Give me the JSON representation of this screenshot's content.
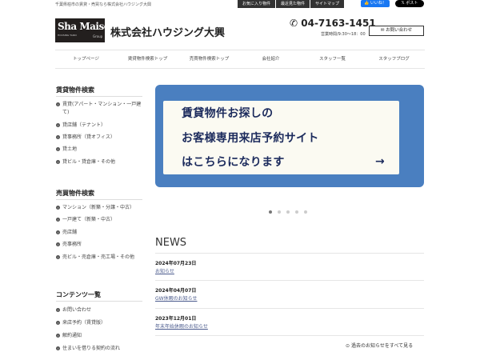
{
  "top": {
    "tagline": "千葉県柏市の賃貸・売買なら株式会社ハウジング大興",
    "links": [
      "お気に入り物件",
      "最近見た物件",
      "サイトマップ"
    ],
    "facebook_label": "いいね！",
    "x_label": "ポスト"
  },
  "header": {
    "logo_main": "Sha Maison",
    "logo_sub": "HOUSING TAIKO",
    "logo_group": "Group",
    "company": "株式会社ハウジング大興",
    "phone": "04-7163-1451",
    "hours": "営業時間/9:30～18：00",
    "contact_label": "お問い合わせ"
  },
  "nav": [
    "トップページ",
    "賃貸物件検索トップ",
    "売買物件検索トップ",
    "会社紹介",
    "スタッフ一覧",
    "スタッフブログ"
  ],
  "sidebar": {
    "rental_heading": "賃貸物件検索",
    "rental_items": [
      "賃貸(アパート・マンション・一戸建て)",
      "貸店舗（テナント）",
      "貸事務所（貸オフィス）",
      "貸土地",
      "貸ビル・貸倉庫・その他"
    ],
    "sale_heading": "売買物件検索",
    "sale_items": [
      "マンション（新築・分譲・中古）",
      "一戸建て（新築・中古）",
      "売店舗",
      "売事務所",
      "売ビル・売倉庫・売工場・その他"
    ],
    "content_heading": "コンテンツ一覧",
    "content_items": [
      "お問い合わせ",
      "来店予約（賃貸版）",
      "解約通知",
      "住まいを借りる契約の流れ"
    ]
  },
  "banner": {
    "line1": "賃貸物件お探しの",
    "line2": "お客様専用来店予約サイト",
    "line3": "はこちらになります",
    "arrow": "→"
  },
  "slider": {
    "count": 5,
    "active": 0
  },
  "news": {
    "title": "NEWS",
    "items": [
      {
        "date": "2024年07月23日",
        "link": "お知らせ"
      },
      {
        "date": "2024年04月07日",
        "link": "GW休暇のお知らせ"
      },
      {
        "date": "2023年12月01日",
        "link": "年末年始休暇のお知らせ"
      }
    ],
    "more_label": "過去のお知らせをすべて見る"
  },
  "colors": {
    "banner_blue": "#4a7fc0",
    "banner_text": "#1b2a5c",
    "dark": "#333333"
  }
}
